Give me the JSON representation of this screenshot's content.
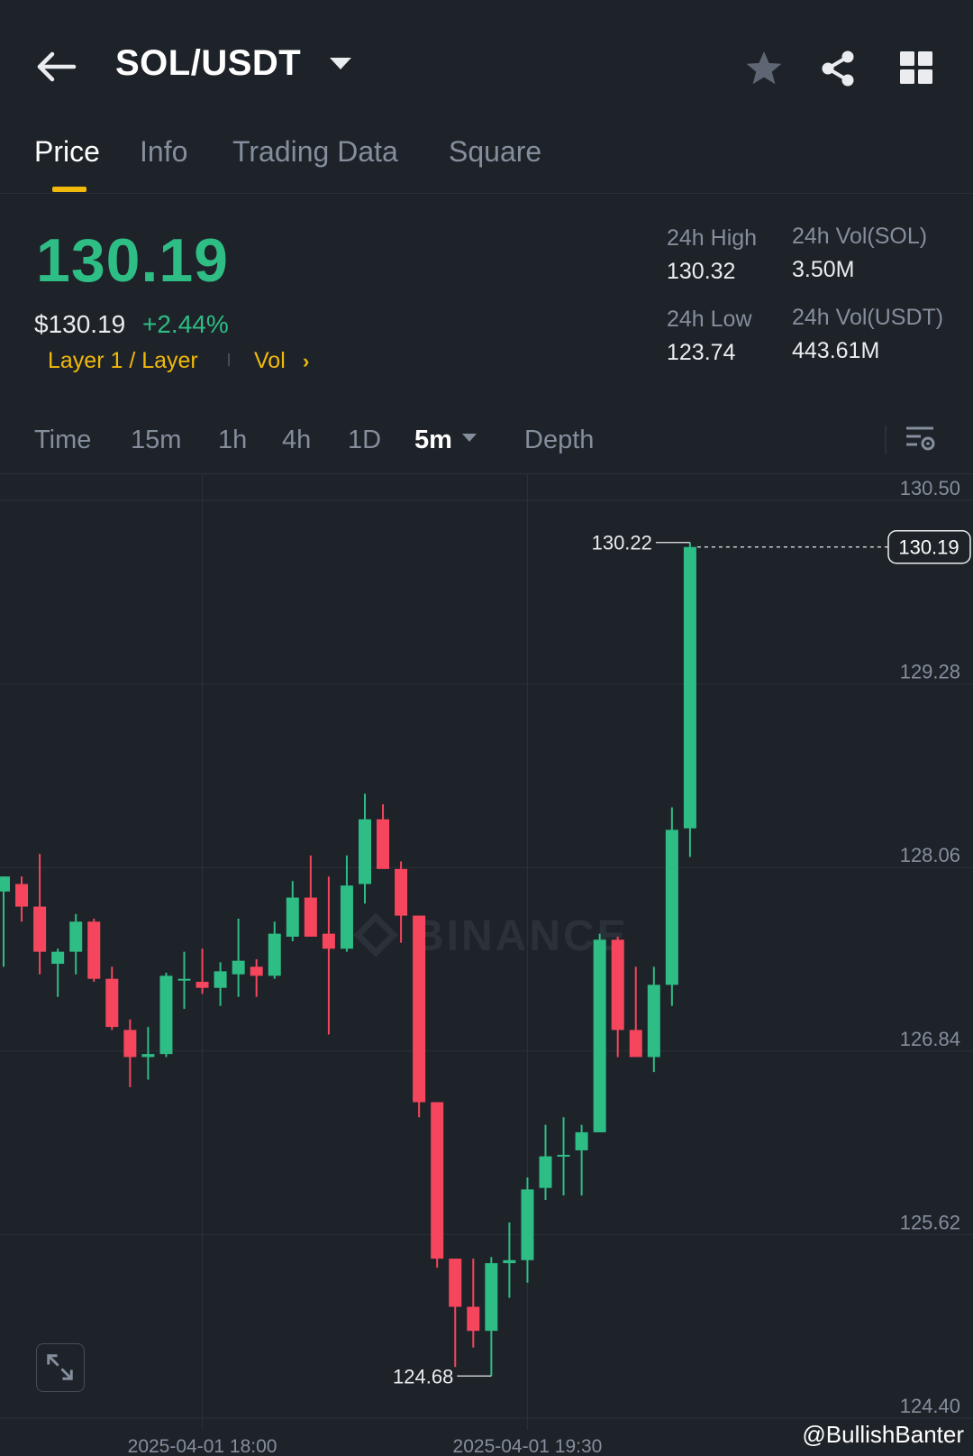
{
  "header": {
    "pair": "SOL/USDT",
    "tabs": [
      "Price",
      "Info",
      "Trading Data",
      "Square"
    ],
    "active_tab": "Price"
  },
  "price": {
    "last": "130.19",
    "usd": "$130.19",
    "change_pct": "+2.44%",
    "tag_category": "Layer 1 / Layer",
    "tag_vol": "Vol"
  },
  "stats": {
    "high_label": "24h High",
    "high": "130.32",
    "low_label": "24h Low",
    "low": "123.74",
    "vol_sol_label": "24h Vol(SOL)",
    "vol_sol": "3.50M",
    "vol_usdt_label": "24h Vol(USDT)",
    "vol_usdt": "443.61M"
  },
  "intervals": {
    "items": [
      "Time",
      "15m",
      "1h",
      "4h",
      "1D"
    ],
    "selected": "5m",
    "depth": "Depth"
  },
  "colors": {
    "up": "#2ebd85",
    "down": "#f6465d",
    "accent": "#f0b90b",
    "background": "#1e2329"
  },
  "icons": {
    "back": "arrow-left-icon",
    "favorite": "star-icon",
    "share": "share-icon",
    "layout": "grid-icon",
    "settings": "chart-settings-icon",
    "expand": "expand-icon"
  },
  "chart_data": {
    "type": "candlestick",
    "y_ticks": [
      "130.50",
      "129.28",
      "128.06",
      "126.84",
      "125.62",
      "124.40"
    ],
    "ylim": [
      124.4,
      130.5
    ],
    "x_ticks": [
      "2025-04-01 18:00",
      "2025-04-01 19:30"
    ],
    "x_tick_index": [
      11,
      29
    ],
    "current_price": "130.19",
    "high_marker": "130.22",
    "low_marker": "124.68",
    "watermark_logo": "BINANCE",
    "candles": [
      {
        "o": 127.9,
        "h": 128.0,
        "l": 127.4,
        "c": 128.0
      },
      {
        "o": 127.95,
        "h": 128.0,
        "l": 127.7,
        "c": 127.8
      },
      {
        "o": 127.8,
        "h": 128.15,
        "l": 127.35,
        "c": 127.5
      },
      {
        "o": 127.42,
        "h": 127.52,
        "l": 127.2,
        "c": 127.5
      },
      {
        "o": 127.5,
        "h": 127.75,
        "l": 127.35,
        "c": 127.7
      },
      {
        "o": 127.7,
        "h": 127.72,
        "l": 127.3,
        "c": 127.32
      },
      {
        "o": 127.32,
        "h": 127.4,
        "l": 126.98,
        "c": 127.0
      },
      {
        "o": 126.98,
        "h": 127.05,
        "l": 126.6,
        "c": 126.8
      },
      {
        "o": 126.8,
        "h": 127.0,
        "l": 126.65,
        "c": 126.82
      },
      {
        "o": 126.82,
        "h": 127.36,
        "l": 126.8,
        "c": 127.34
      },
      {
        "o": 127.32,
        "h": 127.5,
        "l": 127.12,
        "c": 127.32
      },
      {
        "o": 127.3,
        "h": 127.52,
        "l": 127.22,
        "c": 127.26
      },
      {
        "o": 127.26,
        "h": 127.43,
        "l": 127.14,
        "c": 127.37
      },
      {
        "o": 127.35,
        "h": 127.72,
        "l": 127.2,
        "c": 127.44
      },
      {
        "o": 127.4,
        "h": 127.45,
        "l": 127.2,
        "c": 127.34
      },
      {
        "o": 127.34,
        "h": 127.7,
        "l": 127.32,
        "c": 127.62
      },
      {
        "o": 127.6,
        "h": 127.97,
        "l": 127.57,
        "c": 127.86
      },
      {
        "o": 127.86,
        "h": 128.14,
        "l": 127.6,
        "c": 127.6
      },
      {
        "o": 127.62,
        "h": 128.0,
        "l": 126.95,
        "c": 127.52
      },
      {
        "o": 127.52,
        "h": 128.14,
        "l": 127.5,
        "c": 127.94
      },
      {
        "o": 127.95,
        "h": 128.55,
        "l": 127.82,
        "c": 128.38
      },
      {
        "o": 128.38,
        "h": 128.48,
        "l": 128.06,
        "c": 128.05
      },
      {
        "o": 128.05,
        "h": 128.1,
        "l": 127.56,
        "c": 127.74
      },
      {
        "o": 127.74,
        "h": 127.74,
        "l": 126.4,
        "c": 126.5
      },
      {
        "o": 126.5,
        "h": 126.5,
        "l": 125.4,
        "c": 125.46
      },
      {
        "o": 125.46,
        "h": 125.46,
        "l": 124.74,
        "c": 125.14
      },
      {
        "o": 125.14,
        "h": 125.46,
        "l": 124.87,
        "c": 124.98
      },
      {
        "o": 124.98,
        "h": 125.47,
        "l": 124.68,
        "c": 125.43
      },
      {
        "o": 125.43,
        "h": 125.7,
        "l": 125.2,
        "c": 125.45
      },
      {
        "o": 125.45,
        "h": 126.0,
        "l": 125.3,
        "c": 125.92
      },
      {
        "o": 125.93,
        "h": 126.35,
        "l": 125.85,
        "c": 126.14
      },
      {
        "o": 126.14,
        "h": 126.4,
        "l": 125.88,
        "c": 126.15
      },
      {
        "o": 126.18,
        "h": 126.35,
        "l": 125.88,
        "c": 126.3
      },
      {
        "o": 126.3,
        "h": 127.62,
        "l": 126.3,
        "c": 127.58
      },
      {
        "o": 127.58,
        "h": 127.6,
        "l": 126.8,
        "c": 126.98
      },
      {
        "o": 126.98,
        "h": 127.4,
        "l": 126.8,
        "c": 126.8
      },
      {
        "o": 126.8,
        "h": 127.4,
        "l": 126.7,
        "c": 127.28
      },
      {
        "o": 127.28,
        "h": 128.46,
        "l": 127.14,
        "c": 128.31
      },
      {
        "o": 128.32,
        "h": 130.22,
        "l": 128.13,
        "c": 130.19
      }
    ]
  },
  "watermark": "@BullishBanter"
}
